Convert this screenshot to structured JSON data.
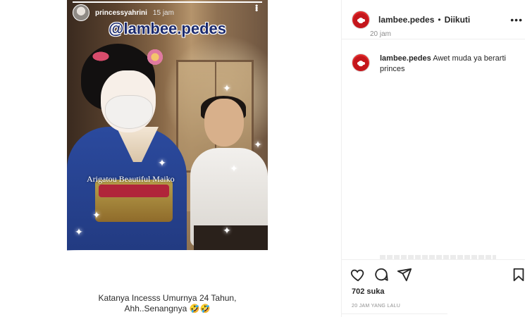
{
  "story": {
    "username": "princessyahrini",
    "time": "15 jam",
    "overlay_handle": "@lambee.pedes",
    "overlay_text": "Arigatou Beautiful Maiko",
    "caption_line1": "Katanya Incesss Umurnya 24 Tahun,",
    "caption_line2": "Ahh..Senangnya 🤣🤣"
  },
  "post": {
    "username": "lambee.pedes",
    "separator": "•",
    "follow_status": "Diikuti",
    "more_label": "•••",
    "comment": {
      "username": "lambee.pedes",
      "text": "Awet muda ya berarti princes",
      "time": "20 jam"
    },
    "likes": "702 suka",
    "timestamp": "20 JAM YANG LALU"
  },
  "icons": {
    "like": "heart-icon",
    "comment": "comment-icon",
    "share": "share-icon",
    "save": "bookmark-icon"
  },
  "colors": {
    "brand_red": "#c4161c",
    "text_primary": "#262626",
    "text_secondary": "#8e8e8e",
    "handle_blue": "#1b2a6e"
  }
}
